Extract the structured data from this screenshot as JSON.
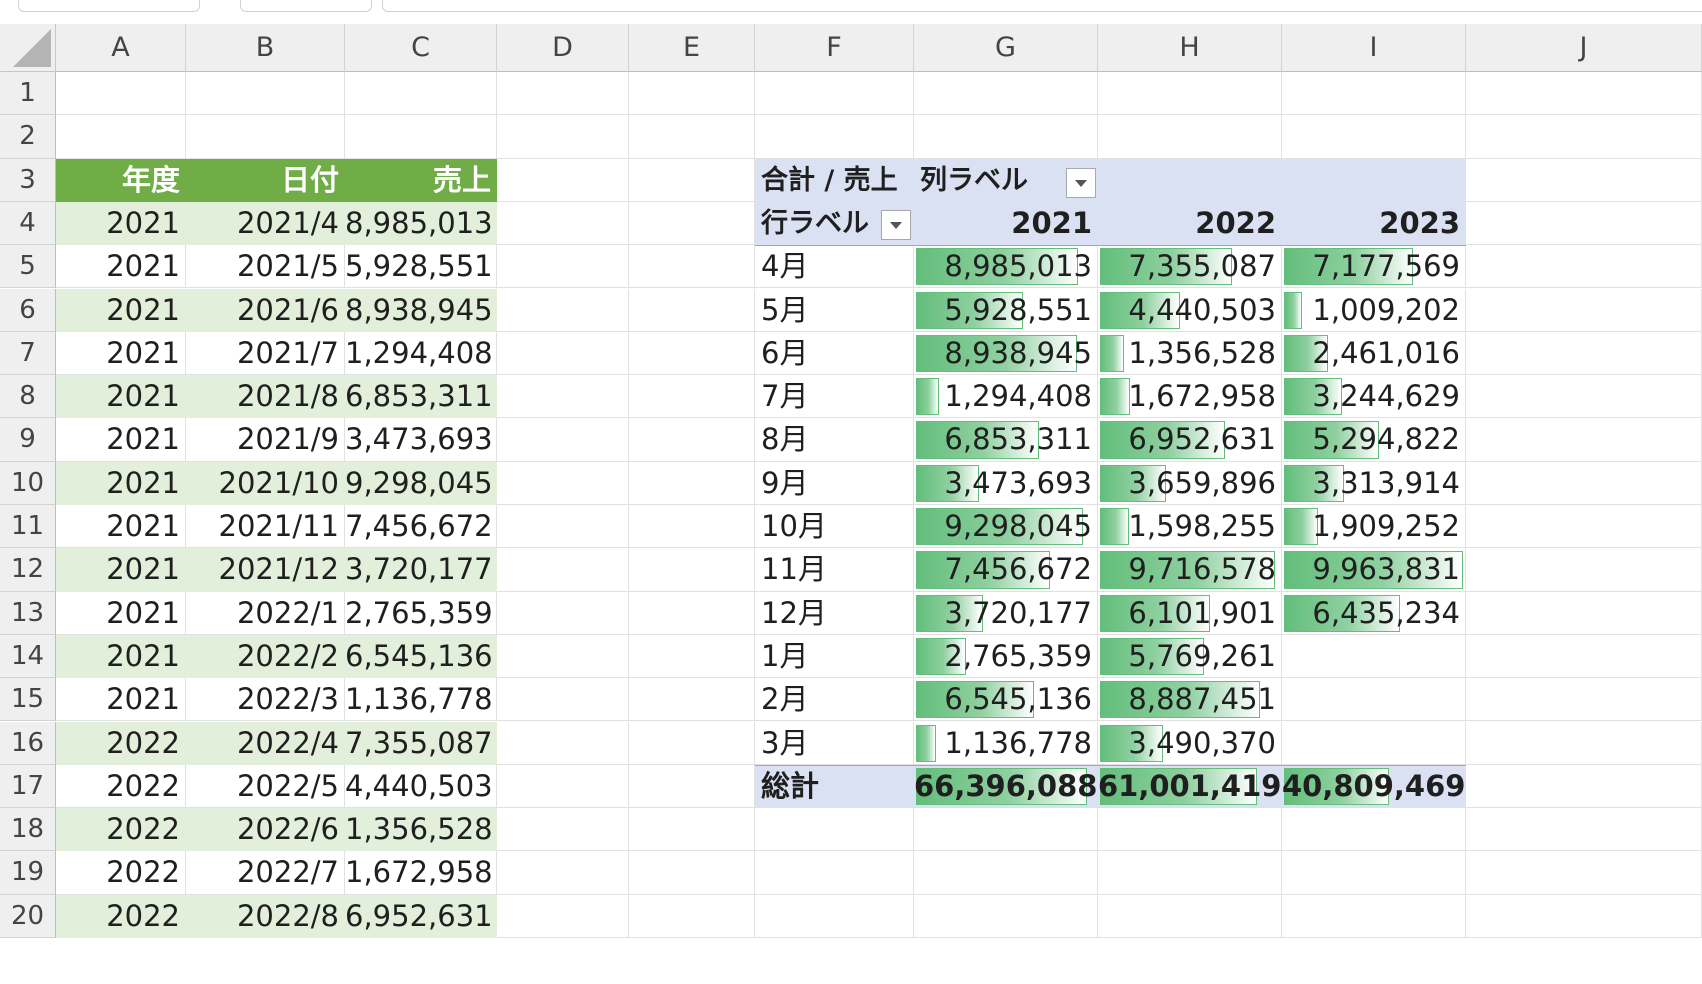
{
  "columns": [
    "A",
    "B",
    "C",
    "D",
    "E",
    "F",
    "G",
    "H",
    "I",
    "J"
  ],
  "rows": [
    "1",
    "2",
    "3",
    "4",
    "5",
    "6",
    "7",
    "8",
    "9",
    "10",
    "11",
    "12",
    "13",
    "14",
    "15",
    "16",
    "17",
    "18",
    "19",
    "20"
  ],
  "source_table": {
    "headers": [
      "年度",
      "日付",
      "売上"
    ],
    "rows": [
      [
        "2021",
        "2021/4",
        "8,985,013"
      ],
      [
        "2021",
        "2021/5",
        "5,928,551"
      ],
      [
        "2021",
        "2021/6",
        "8,938,945"
      ],
      [
        "2021",
        "2021/7",
        "1,294,408"
      ],
      [
        "2021",
        "2021/8",
        "6,853,311"
      ],
      [
        "2021",
        "2021/9",
        "3,473,693"
      ],
      [
        "2021",
        "2021/10",
        "9,298,045"
      ],
      [
        "2021",
        "2021/11",
        "7,456,672"
      ],
      [
        "2021",
        "2021/12",
        "3,720,177"
      ],
      [
        "2021",
        "2022/1",
        "2,765,359"
      ],
      [
        "2021",
        "2022/2",
        "6,545,136"
      ],
      [
        "2021",
        "2022/3",
        "1,136,778"
      ],
      [
        "2022",
        "2022/4",
        "7,355,087"
      ],
      [
        "2022",
        "2022/5",
        "4,440,503"
      ],
      [
        "2022",
        "2022/6",
        "1,356,528"
      ],
      [
        "2022",
        "2022/7",
        "1,672,958"
      ],
      [
        "2022",
        "2022/8",
        "6,952,631"
      ]
    ]
  },
  "pivot": {
    "value_label": "合計 / 売上",
    "col_label": "列ラベル",
    "row_label": "行ラベル",
    "years": [
      "2021",
      "2022",
      "2023"
    ],
    "rows": [
      {
        "label": "4月",
        "values": [
          8985013,
          7355087,
          7177569
        ],
        "display": [
          "8,985,013",
          "7,355,087",
          "7,177,569"
        ]
      },
      {
        "label": "5月",
        "values": [
          5928551,
          4440503,
          1009202
        ],
        "display": [
          "5,928,551",
          "4,440,503",
          "1,009,202"
        ]
      },
      {
        "label": "6月",
        "values": [
          8938945,
          1356528,
          2461016
        ],
        "display": [
          "8,938,945",
          "1,356,528",
          "2,461,016"
        ]
      },
      {
        "label": "7月",
        "values": [
          1294408,
          1672958,
          3244629
        ],
        "display": [
          "1,294,408",
          "1,672,958",
          "3,244,629"
        ]
      },
      {
        "label": "8月",
        "values": [
          6853311,
          6952631,
          5294822
        ],
        "display": [
          "6,853,311",
          "6,952,631",
          "5,294,822"
        ]
      },
      {
        "label": "9月",
        "values": [
          3473693,
          3659896,
          3313914
        ],
        "display": [
          "3,473,693",
          "3,659,896",
          "3,313,914"
        ]
      },
      {
        "label": "10月",
        "values": [
          9298045,
          1598255,
          1909252
        ],
        "display": [
          "9,298,045",
          "1,598,255",
          "1,909,252"
        ]
      },
      {
        "label": "11月",
        "values": [
          7456672,
          9716578,
          9963831
        ],
        "display": [
          "7,456,672",
          "9,716,578",
          "9,963,831"
        ]
      },
      {
        "label": "12月",
        "values": [
          3720177,
          6101901,
          6435234
        ],
        "display": [
          "3,720,177",
          "6,101,901",
          "6,435,234"
        ]
      },
      {
        "label": "1月",
        "values": [
          2765359,
          5769261,
          null
        ],
        "display": [
          "2,765,359",
          "5,769,261",
          ""
        ]
      },
      {
        "label": "2月",
        "values": [
          6545136,
          8887451,
          null
        ],
        "display": [
          "6,545,136",
          "8,887,451",
          ""
        ]
      },
      {
        "label": "3月",
        "values": [
          1136778,
          3490370,
          null
        ],
        "display": [
          "1,136,778",
          "3,490,370",
          ""
        ]
      }
    ],
    "total": {
      "label": "総計",
      "values": [
        66396088,
        61001419,
        40809469
      ],
      "display": [
        "66,396,088",
        "61,001,419",
        "40,809,469"
      ]
    }
  },
  "colors": {
    "header_green": "#70ad47",
    "band_green": "#e2efda",
    "pivot_header": "#dae1f3",
    "databar": "#63be7b"
  }
}
